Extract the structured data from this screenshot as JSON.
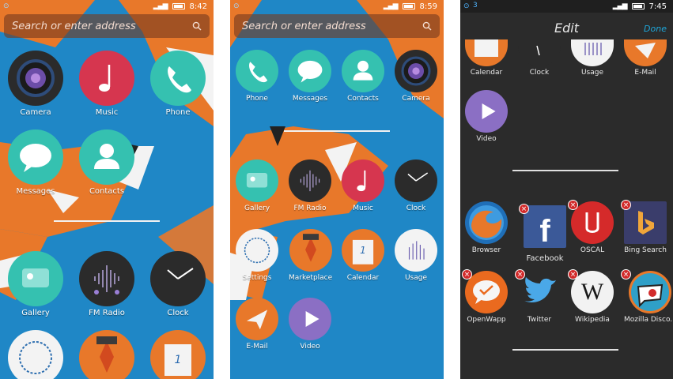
{
  "panel1": {
    "status_time": "8:42",
    "search_placeholder": "Search or enter address",
    "apps": [
      "Camera",
      "Music",
      "Phone",
      "Messages",
      "Contacts",
      "Gallery",
      "FM Radio",
      "Clock"
    ],
    "calendar_day": "1"
  },
  "panel2": {
    "status_time": "8:59",
    "search_placeholder": "Search or enter address",
    "apps": [
      "Phone",
      "Messages",
      "Contacts",
      "Camera",
      "Gallery",
      "FM Radio",
      "Music",
      "Clock",
      "Settings",
      "Marketplace",
      "Calendar",
      "Usage",
      "E-Mail",
      "Video"
    ],
    "calendar_day": "1"
  },
  "panel3": {
    "status_left": "3",
    "status_time": "7:45",
    "title": "Edit",
    "done": "Done",
    "top_apps": [
      "Calendar",
      "Clock",
      "Usage",
      "E-Mail",
      "Video"
    ],
    "bottom_apps": [
      "Browser",
      "Facebook",
      "OSCAL",
      "Bing Search",
      "OpenWapp",
      "Twitter",
      "Wikipedia",
      "Mozilla Disco..."
    ]
  },
  "icons": {
    "delete_badge": "×",
    "wikipedia": "W",
    "facebook": "f"
  },
  "colors": {
    "wallpaper_blue": "#1f87c6",
    "fox_orange": "#e8782a",
    "edit_bg": "#2b2b2b",
    "accent_blue": "#1ea6d9",
    "delete_red": "#d22b2b"
  }
}
